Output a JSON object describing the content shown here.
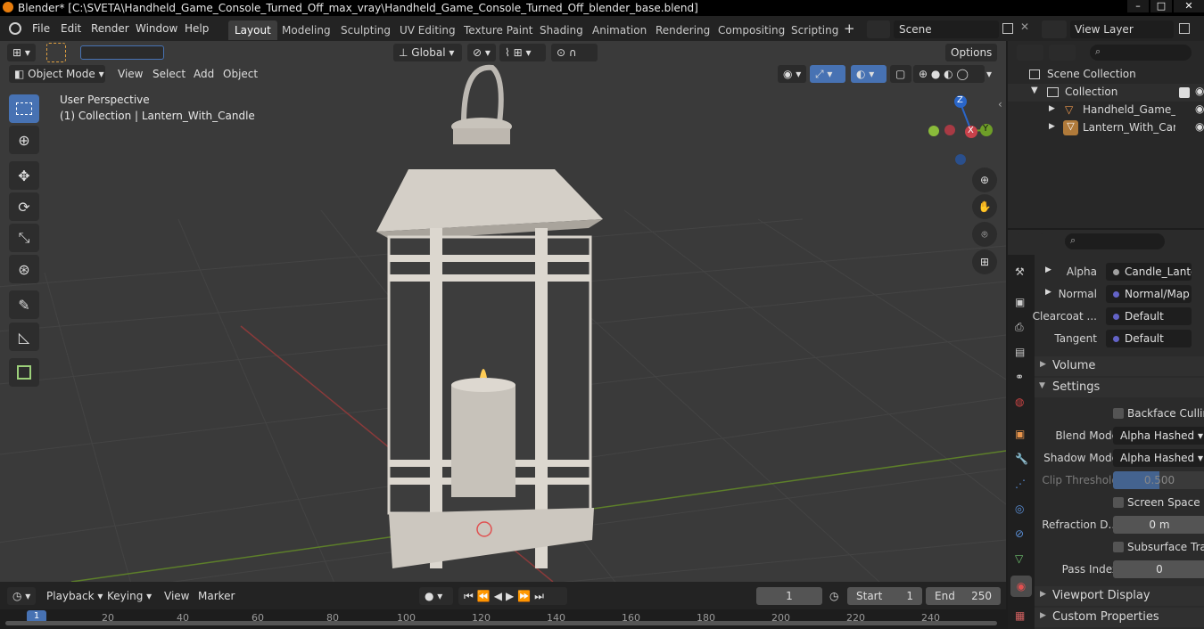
{
  "window": {
    "title": "Blender* [C:\\SVETA\\Handheld_Game_Console_Turned_Off_max_vray\\Handheld_Game_Console_Turned_Off_blender_base.blend]"
  },
  "menu": [
    "File",
    "Edit",
    "Render",
    "Window",
    "Help"
  ],
  "workspaces": [
    "Layout",
    "Modeling",
    "Sculpting",
    "UV Editing",
    "Texture Paint",
    "Shading",
    "Animation",
    "Rendering",
    "Compositing",
    "Scripting"
  ],
  "active_workspace": "Layout",
  "scene": {
    "name": "Scene",
    "view_layer": "View Layer"
  },
  "viewport": {
    "mode": "Object Mode",
    "header_menus": [
      "View",
      "Select",
      "Add",
      "Object"
    ],
    "orientation": "Global",
    "options": "Options",
    "perspective": "User Perspective",
    "collection_info": "(1) Collection | Lantern_With_Candle",
    "gizmo": {
      "z": "Z",
      "x": "X",
      "y": "Y"
    }
  },
  "outliner": {
    "root": "Scene Collection",
    "collection": "Collection",
    "items": [
      "Handheld_Game_Cor",
      "Lantern_With_Candle"
    ]
  },
  "properties": {
    "rows": [
      {
        "label": "Alpha",
        "value": "Candle_Lante..."
      },
      {
        "label": "Normal",
        "value": "Normal/Map"
      },
      {
        "label": "Clearcoat ...",
        "value": "Default"
      },
      {
        "label": "Tangent",
        "value": "Default"
      }
    ],
    "volume": "Volume",
    "settings": "Settings",
    "backface": "Backface Culling",
    "blend_mode": {
      "label": "Blend Mode",
      "value": "Alpha Hashed"
    },
    "shadow_mode": {
      "label": "Shadow Mode",
      "value": "Alpha Hashed"
    },
    "clip_threshold": {
      "label": "Clip Threshold",
      "value": "0.500"
    },
    "screen_space": "Screen Space R...",
    "refraction": {
      "label": "Refraction D...",
      "value": "0 m"
    },
    "subsurface": "Subsurface Tran...",
    "pass_index": {
      "label": "Pass Index",
      "value": "0"
    },
    "viewport_display": "Viewport Display",
    "custom_props": "Custom Properties"
  },
  "timeline": {
    "menus": [
      "Playback",
      "Keying",
      "View",
      "Marker"
    ],
    "current_frame": "1",
    "start_label": "Start",
    "start": "1",
    "end_label": "End",
    "end": "250",
    "ticks": [
      "1",
      "20",
      "40",
      "60",
      "80",
      "100",
      "120",
      "140",
      "160",
      "180",
      "200",
      "220",
      "240"
    ]
  },
  "colors": {
    "accent": "#4772b3",
    "x_axis": "#c8414a",
    "y_axis": "#6e9e28",
    "z_axis": "#2a66c9"
  }
}
